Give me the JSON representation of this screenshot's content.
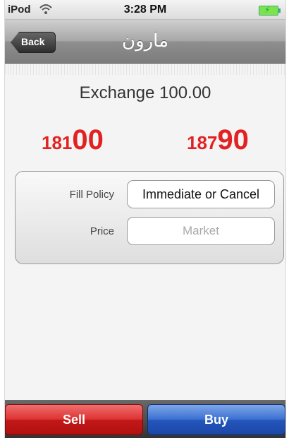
{
  "status": {
    "device": "iPod",
    "time": "3:28 PM",
    "wifi_icon": "wifi-icon",
    "battery_icon": "battery-charging-icon"
  },
  "nav": {
    "back_label": "Back",
    "title": "مارون"
  },
  "main": {
    "exchange_label": "Exchange 100.00",
    "sell_price": {
      "prefix": "181",
      "emphasis": "00"
    },
    "buy_price": {
      "prefix": "187",
      "emphasis": "90"
    },
    "form": {
      "fill_policy_label": "Fill Policy",
      "fill_policy_value": "Immediate or Cancel",
      "price_label": "Price",
      "price_placeholder": "Market"
    }
  },
  "actions": {
    "sell_label": "Sell",
    "buy_label": "Buy"
  },
  "colors": {
    "price_red": "#e22222",
    "sell_red": "#dd3030",
    "buy_blue": "#2456bd"
  }
}
